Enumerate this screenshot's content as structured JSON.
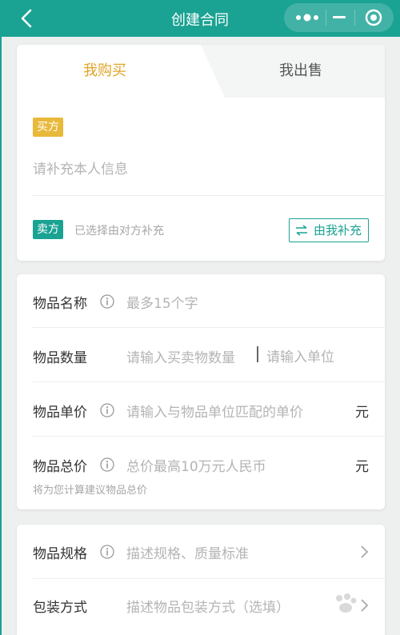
{
  "header": {
    "title": "创建合同",
    "back_icon": "chevron-left-icon",
    "more_icon": "more-dots-icon",
    "minimize_icon": "minus-icon",
    "close_icon": "target-circle-icon",
    "color": "#1aa293"
  },
  "tabs": {
    "buy_label": "我购买",
    "sell_label": "我出售",
    "active": "buy",
    "active_color": "#e0a526"
  },
  "parties": {
    "buyer_tag": "买方",
    "buyer_placeholder": "请补充本人信息",
    "seller_tag": "卖方",
    "seller_note": "已选择由对方补充",
    "fill_button_label": "由我补充",
    "fill_button_icon": "swap-arrows-icon"
  },
  "item_form": {
    "name": {
      "label": "物品名称",
      "placeholder": "最多15个字"
    },
    "quantity": {
      "label": "物品数量",
      "placeholder": "请输入买卖物数量",
      "unit_placeholder": "请输入单位"
    },
    "unit_price": {
      "label": "物品单价",
      "placeholder": "请输入与物品单位匹配的单价",
      "unit": "元"
    },
    "total_price": {
      "label": "物品总价",
      "placeholder": "总价最高10万元人民币",
      "unit": "元",
      "hint": "将为您计算建议物品总价"
    }
  },
  "spec_form": {
    "spec": {
      "label": "物品规格",
      "placeholder": "描述规格、质量标准"
    },
    "packaging": {
      "label": "包装方式",
      "placeholder": "描述物品包装方式（选填）"
    }
  }
}
